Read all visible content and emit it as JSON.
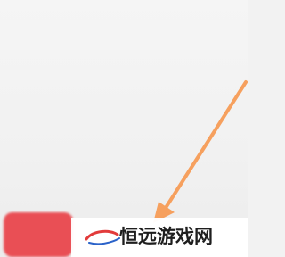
{
  "watermark": {
    "brand_text": "恒远游戏网",
    "logo_icon": "swoosh-logo-icon"
  },
  "annotation": {
    "arrow_icon": "pointer-arrow-icon",
    "arrow_color": "#f6a05e"
  },
  "button": {
    "color": "#e94f55"
  },
  "colors": {
    "background": "#f2f2f2",
    "logo_red": "#e23b3b",
    "logo_blue": "#2a62c9"
  }
}
